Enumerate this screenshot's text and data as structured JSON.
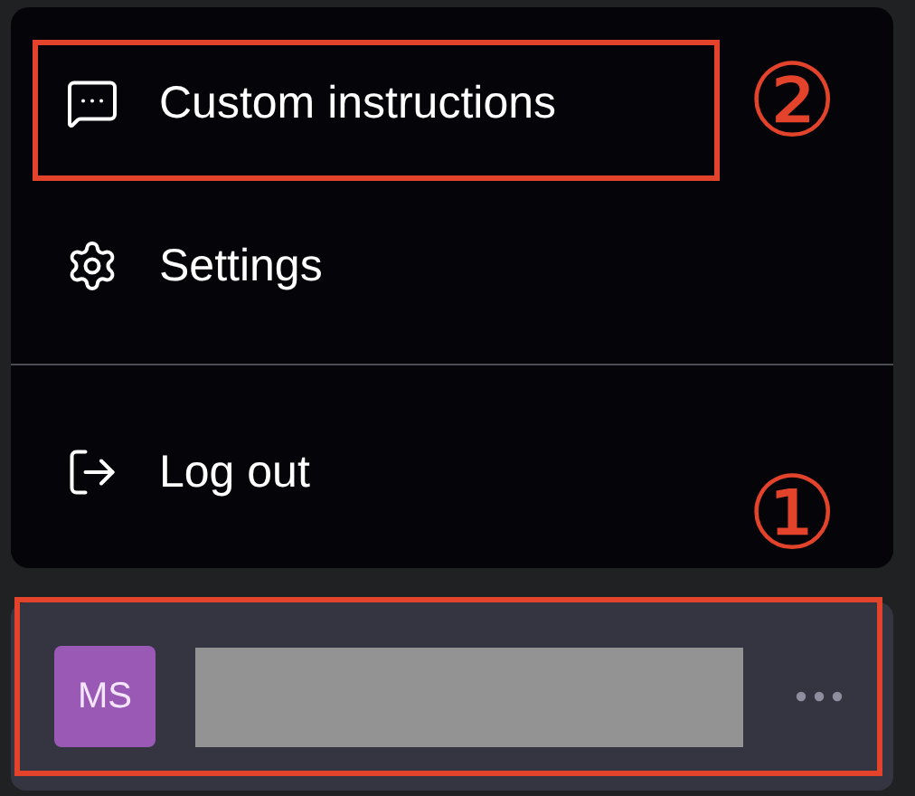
{
  "menu": {
    "sections": [
      {
        "items": [
          {
            "kind": "instructions",
            "label": "Custom instructions",
            "annotation": "②"
          },
          {
            "kind": "settings",
            "label": "Settings"
          }
        ]
      },
      {
        "items": [
          {
            "kind": "logout",
            "label": "Log out"
          }
        ]
      }
    ]
  },
  "profile": {
    "initials": "MS",
    "name": {
      "kind": "redacted"
    },
    "annotation": "①"
  }
}
